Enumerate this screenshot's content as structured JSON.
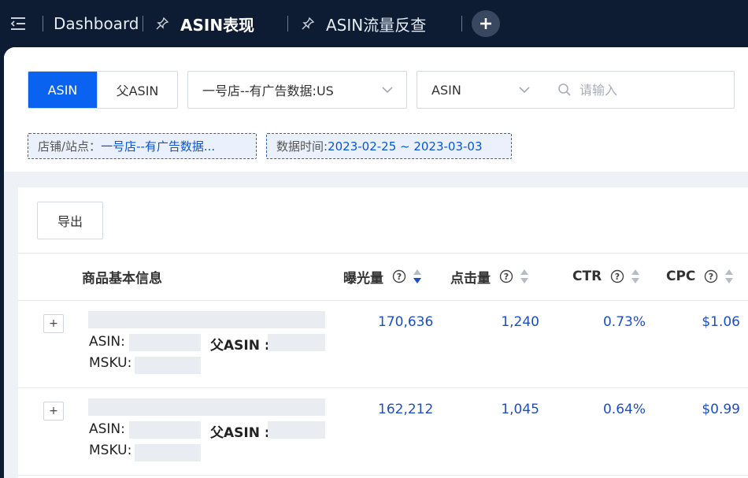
{
  "topbar": {
    "tabs": [
      {
        "label": "Dashboard"
      },
      {
        "label": "ASIN表现"
      },
      {
        "label": "ASIN流量反查"
      }
    ]
  },
  "filters": {
    "mode_toggle": [
      "ASIN",
      "父ASIN"
    ],
    "store_select": "一号店--有广告数据:US",
    "field_select": "ASIN",
    "search_placeholder": "请输入",
    "chips": [
      {
        "key": "店铺/站点：",
        "value": "一号店--有广告数据..."
      },
      {
        "key": "数据时间: ",
        "value": "2023-02-25 ~ 2023-03-03"
      }
    ]
  },
  "table": {
    "export_label": "导出",
    "columns": [
      "商品基本信息",
      "曝光量",
      "点击量",
      "CTR",
      "CPC"
    ],
    "field_labels": {
      "asin": "ASIN:",
      "parent_asin": "父ASIN :",
      "msku": "MSKU:"
    },
    "expand_symbol": "+",
    "rows": [
      {
        "impressions": "170,636",
        "clicks": "1,240",
        "ctr": "0.73%",
        "cpc": "$1.06"
      },
      {
        "impressions": "162,212",
        "clicks": "1,045",
        "ctr": "0.64%",
        "cpc": "$0.99"
      }
    ]
  },
  "colors": {
    "accent": "#0a63f0",
    "topbar": "#0d1b33",
    "value_text": "#1d4fc4"
  }
}
